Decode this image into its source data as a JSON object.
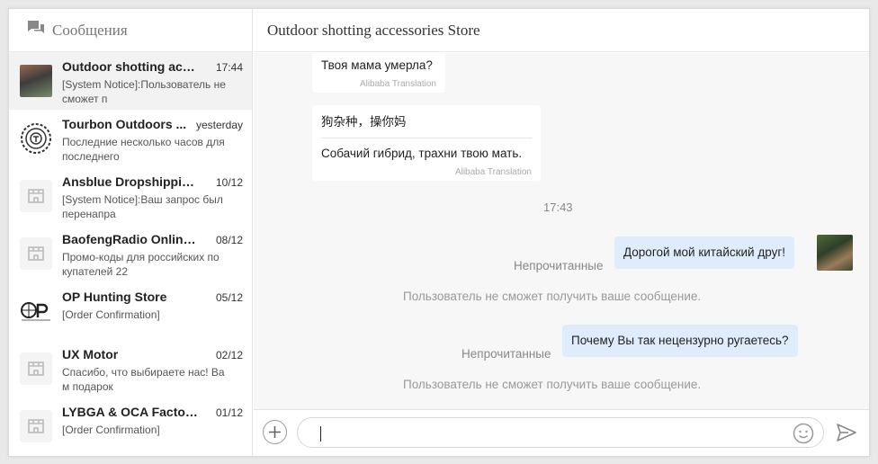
{
  "sidebar": {
    "title": "Сообщения",
    "conversations": [
      {
        "name": "Outdoor shotting acce...",
        "time": "17:44",
        "preview": "[System Notice]:Пользователь не сможет п",
        "avatar": "photo"
      },
      {
        "name": "Tourbon Outdoors ...",
        "time": "yesterday",
        "preview": "Последние несколько часов для последнего",
        "avatar": "tourbon-logo"
      },
      {
        "name": "Ansblue Dropshipping...",
        "time": "10/12",
        "preview": "[System Notice]:Ваш запрос был перенапра",
        "avatar": "store"
      },
      {
        "name": "BaofengRadio Online ...",
        "time": "08/12",
        "preview": "Промо-коды для российских по купателей 22",
        "avatar": "store"
      },
      {
        "name": "OP Hunting Store",
        "time": "05/12",
        "preview": "[Order Confirmation]",
        "avatar": "op-logo"
      },
      {
        "name": "UX Motor",
        "time": "02/12",
        "preview": "Спасибо, что выбираете нас! Ва м подарок",
        "avatar": "store"
      },
      {
        "name": "LYBGA & OCA Factory...",
        "time": "01/12",
        "preview": "[Order Confirmation]",
        "avatar": "store"
      }
    ]
  },
  "chat": {
    "title": "Outdoor shotting accessories Store",
    "incoming": [
      {
        "text": "Твоя мама умерла?",
        "label": "Alibaba Translation"
      },
      {
        "original": "狗杂种，操你妈",
        "text": "Собачий гибрид, трахни твою мать.",
        "label": "Alibaba Translation"
      }
    ],
    "timestamp": "17:43",
    "outgoing": [
      {
        "status": "Непрочитанные",
        "text": "Дорогой мой китайский друг!",
        "notice": "Пользователь не сможет получить ваше сообщение."
      },
      {
        "status": "Непрочитанные",
        "text": "Почему Вы так нецензурно ругаетесь?",
        "notice": "Пользователь не сможет получить ваше сообщение."
      }
    ]
  },
  "composer": {
    "value": "",
    "icons": {
      "add": "plus-circle-icon",
      "emoji": "smiley-icon",
      "send": "send-arrow-icon"
    }
  },
  "colors": {
    "outgoing_bubble": "#dfecfb",
    "incoming_bubble": "#ffffff",
    "chat_bg": "#f7f7f7",
    "active_item": "#f2f2f2"
  }
}
